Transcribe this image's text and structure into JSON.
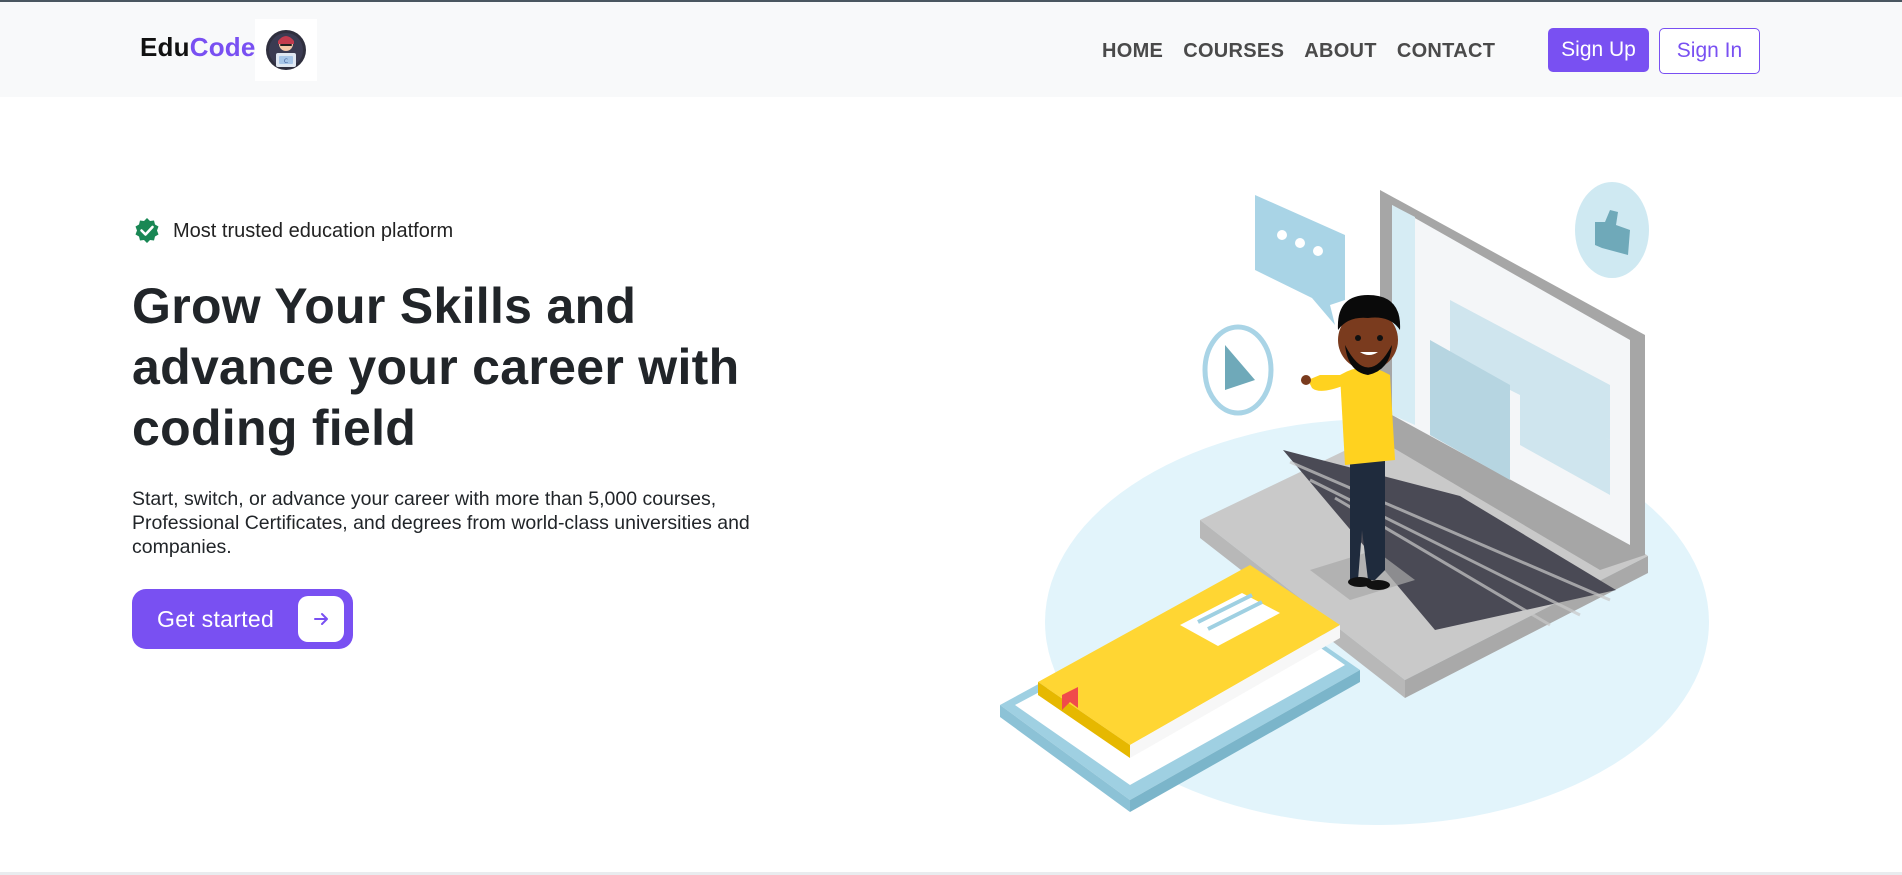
{
  "brand": {
    "part1": "Edu",
    "part2": "Code",
    "accent_color": "#7950f2"
  },
  "nav": {
    "items": [
      "HOME",
      "COURSES",
      "ABOUT",
      "CONTACT"
    ]
  },
  "auth": {
    "signup_label": "Sign Up",
    "signin_label": "Sign In"
  },
  "hero": {
    "badge_text": "Most trusted education platform",
    "badge_icon": "verified-check-icon",
    "badge_color": "#198754",
    "headline": "Grow Your Skills and advance your career with coding field",
    "subtext": "Start, switch, or advance your career with more than 5,000 courses, Professional Certificates, and degrees from world-class universities and companies.",
    "cta_label": "Get started",
    "cta_icon": "arrow-right-icon"
  }
}
